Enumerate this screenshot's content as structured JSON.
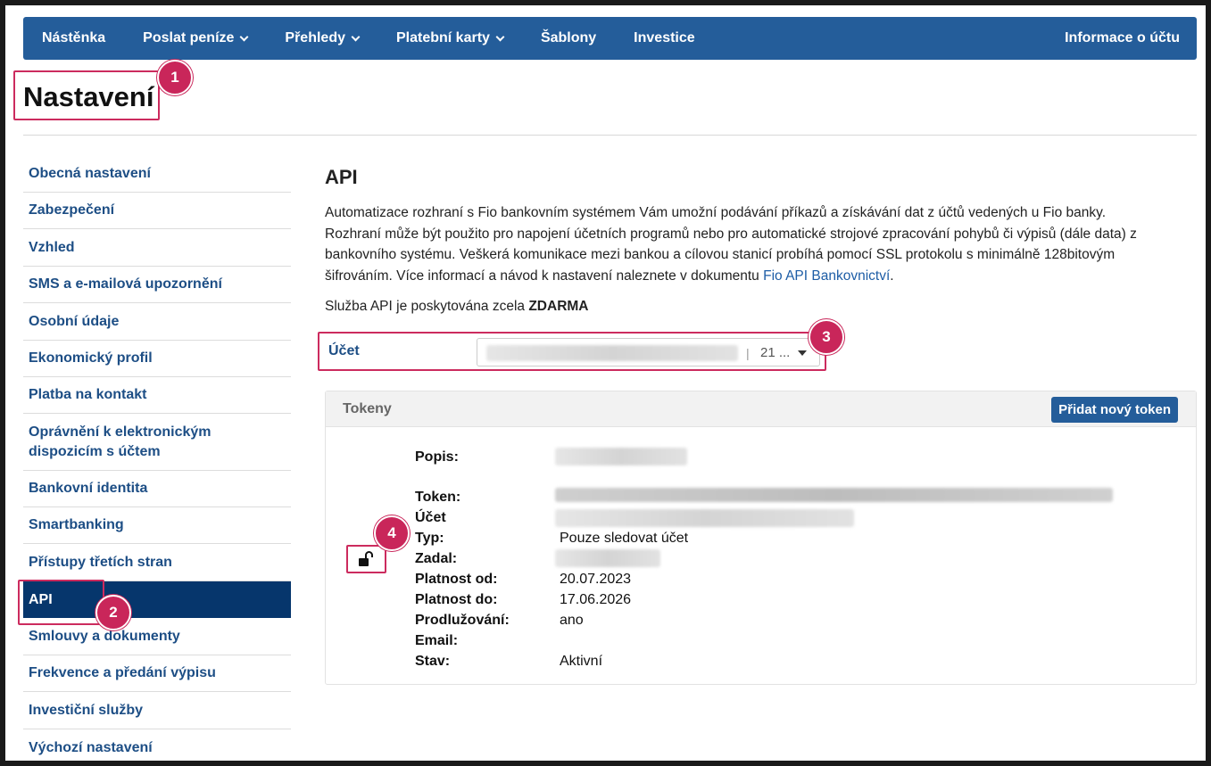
{
  "nav": {
    "items": [
      {
        "label": "Nástěnka",
        "dropdown": false
      },
      {
        "label": "Poslat peníze",
        "dropdown": true
      },
      {
        "label": "Přehledy",
        "dropdown": true
      },
      {
        "label": "Platební karty",
        "dropdown": true
      },
      {
        "label": "Šablony",
        "dropdown": false
      },
      {
        "label": "Investice",
        "dropdown": false
      }
    ],
    "right_label": "Informace o účtu"
  },
  "page": {
    "title": "Nastavení"
  },
  "callouts": [
    "1",
    "2",
    "3",
    "4"
  ],
  "sidebar": {
    "items": [
      "Obecná nastavení",
      "Zabezpečení",
      "Vzhled",
      "SMS a e-mailová upozornění",
      "Osobní údaje",
      "Ekonomický profil",
      "Platba na kontakt",
      "Oprávnění k elektronickým dispozicím s účtem",
      "Bankovní identita",
      "Smartbanking",
      "Přístupy třetích stran",
      "API",
      "Smlouvy a dokumenty",
      "Frekvence a předání výpisu",
      "Investiční služby",
      "Výchozí nastavení"
    ],
    "active_index": 11
  },
  "api": {
    "heading": "API",
    "description": "Automatizace rozhraní s Fio bankovním systémem Vám umožní podávání příkazů a získávání dat z účtů vedených u Fio banky. Rozhraní může být použito pro napojení účetních programů nebo pro automatické strojové zpracování pohybů či výpisů (dále data) z bankovního systému. Veškerá komunikace mezi bankou a cílovou stanicí probíhá pomocí SSL protokolu s minimálně 128bitovým šifrováním. Více informací a návod k nastavení naleznete v dokumentu ",
    "link_text": "Fio API Bankovnictví",
    "link_suffix": ".",
    "free_prefix": "Služba API je poskytována zcela ",
    "free_bold": "ZDARMA"
  },
  "account": {
    "label": "Účet",
    "separator": "|",
    "value_suffix": "21 ..."
  },
  "tokens": {
    "title": "Tokeny",
    "add_button": "Přidat nový token",
    "fields": {
      "popis": "Popis:",
      "token": "Token:",
      "ucet": "Účet",
      "typ": "Typ:",
      "zadal": "Zadal:",
      "platnost_od": "Platnost od:",
      "platnost_do": "Platnost do:",
      "prodluzovani": "Prodlužování:",
      "email": "Email:",
      "stav": "Stav:"
    },
    "values": {
      "typ": "Pouze sledovat účet",
      "platnost_od": "20.07.2023",
      "platnost_do": "17.06.2026",
      "prodluzovani": "ano",
      "stav": "Aktivní"
    }
  },
  "colors": {
    "nav_bg": "#245d9a",
    "active_bg": "#06366c",
    "link": "#1d4e85",
    "highlight": "#cc2b5e"
  },
  "icons": {
    "lock": "unlock-icon"
  }
}
